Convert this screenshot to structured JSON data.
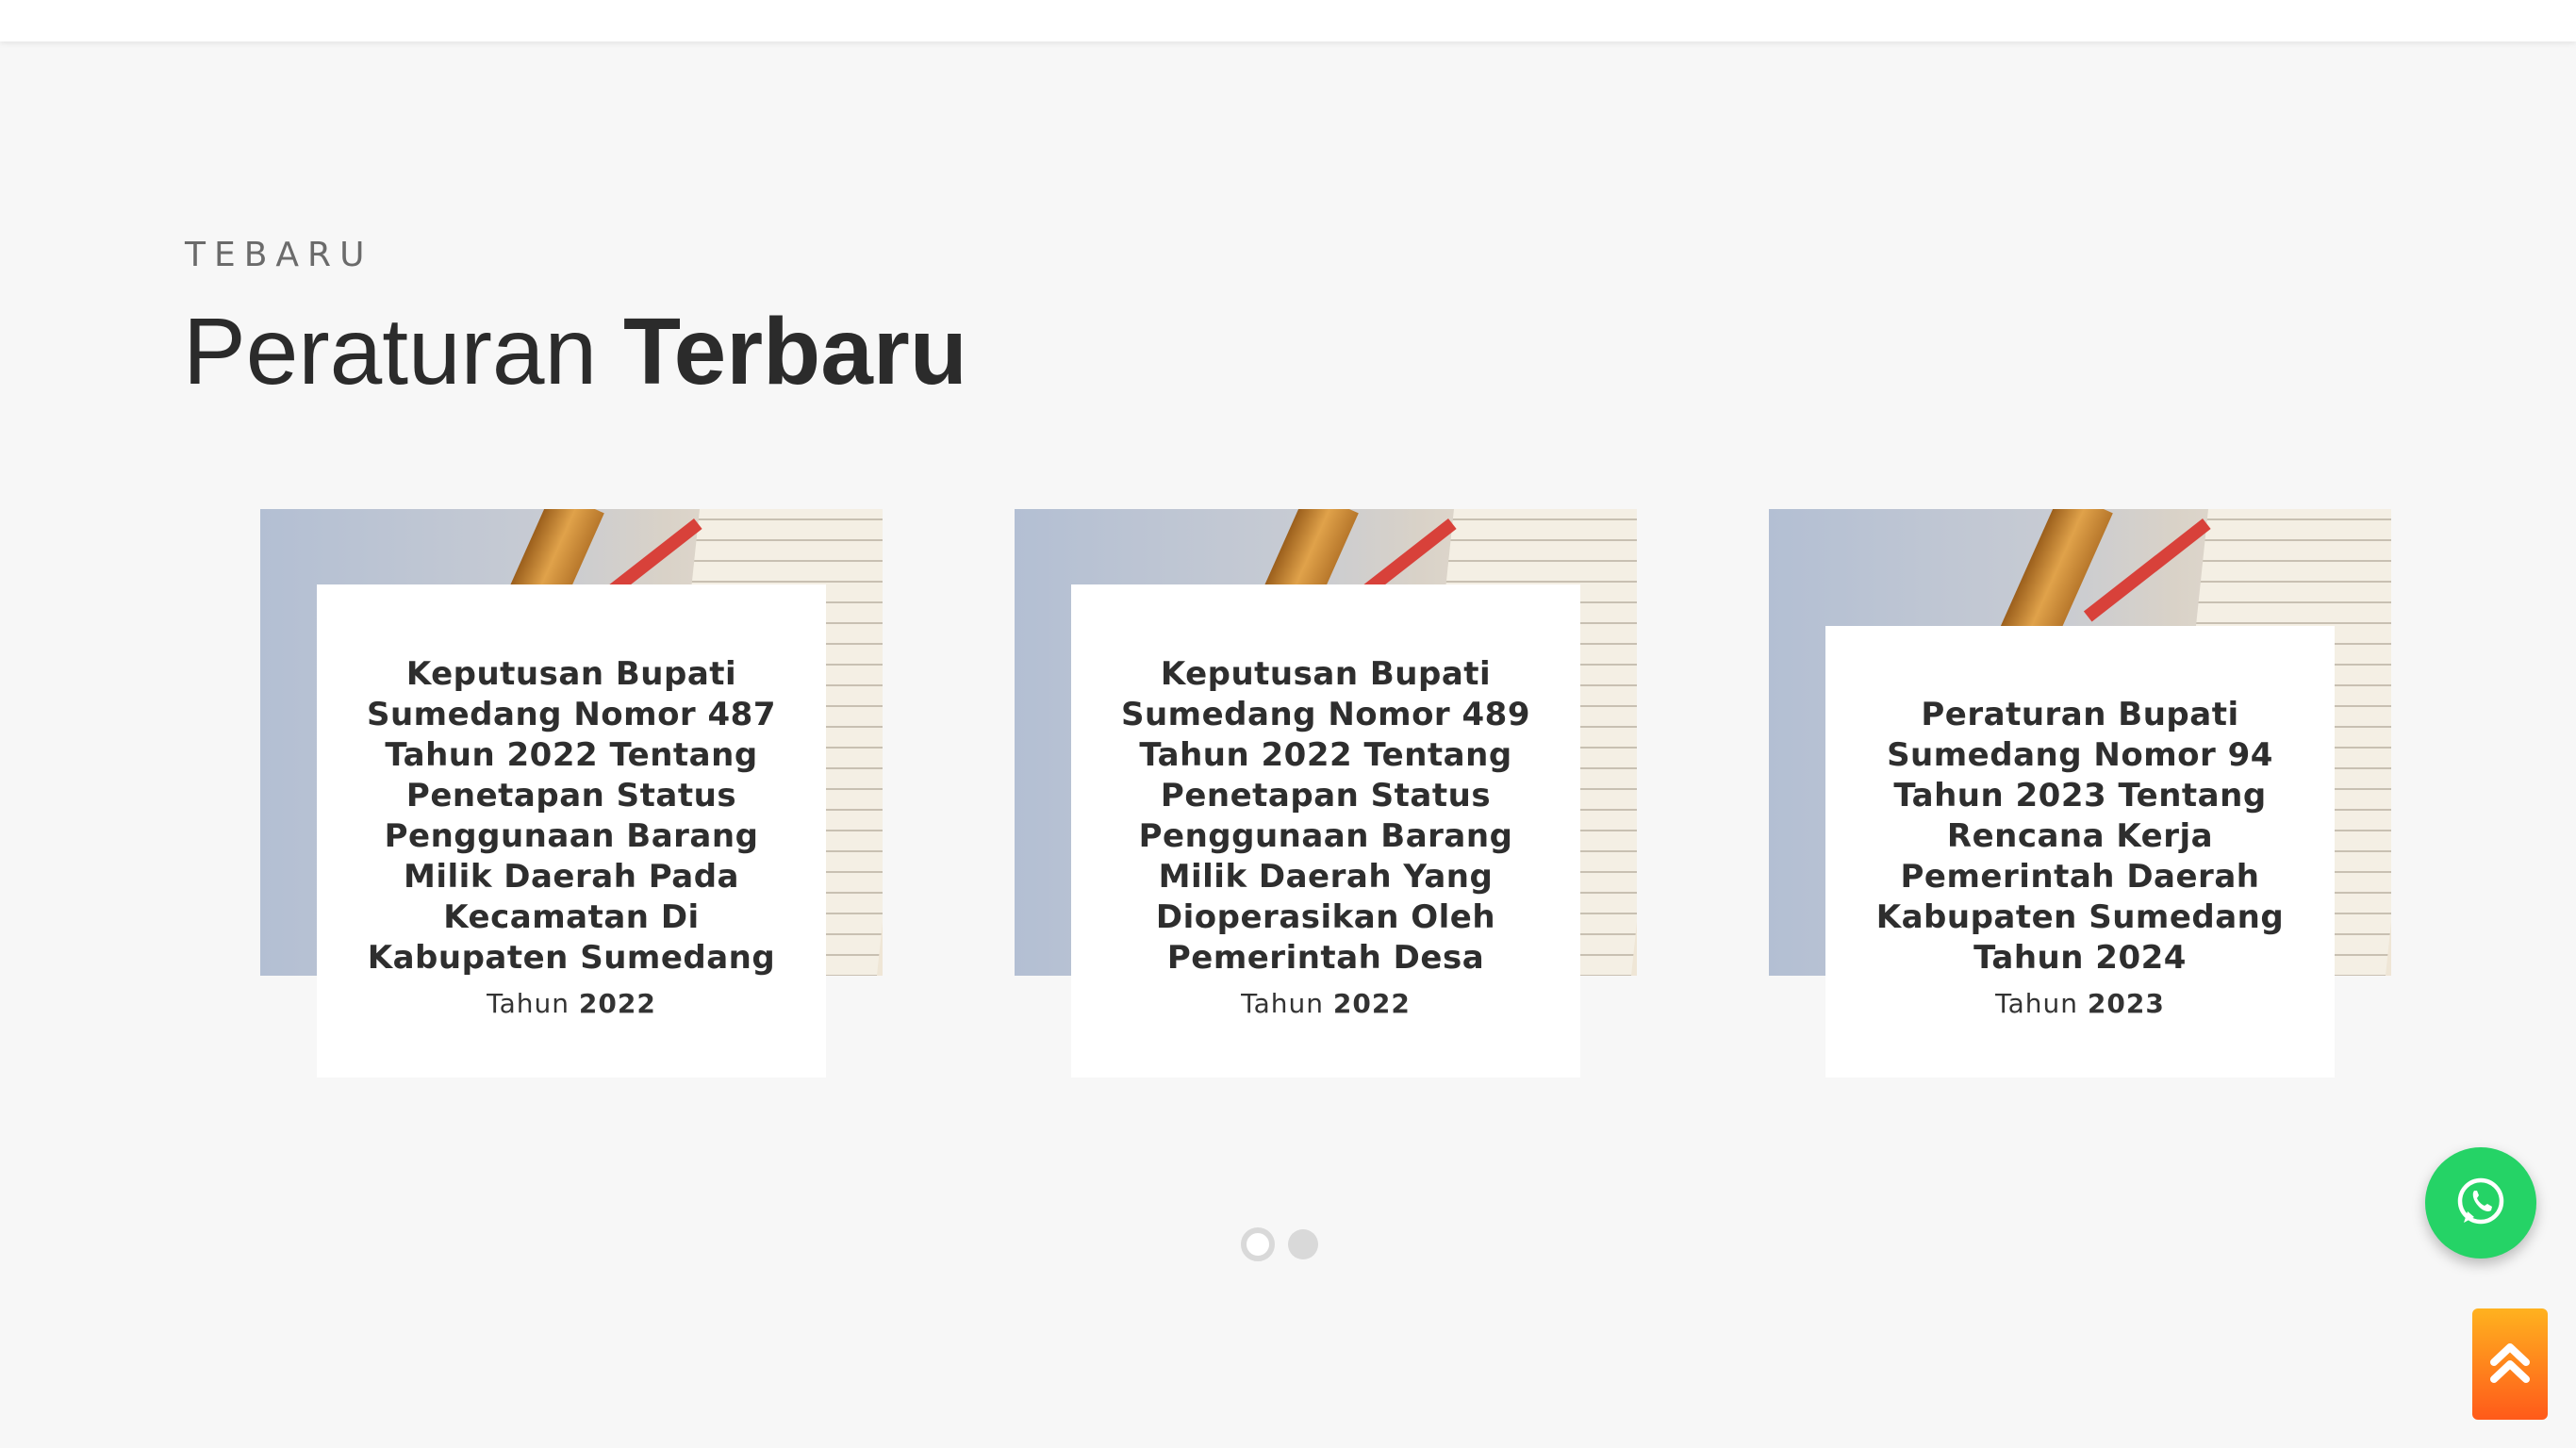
{
  "section": {
    "eyebrow": "TEBARU",
    "title_regular": "Peraturan",
    "title_bold": "Terbaru"
  },
  "cards": [
    {
      "title": "Keputusan Bupati Sumedang Nomor 487 Tahun 2022 Tentang Penetapan Status Penggunaan Barang Milik Daerah Pada Kecamatan Di Kabupaten Sumedang",
      "year_label": "Tahun",
      "year": "2022"
    },
    {
      "title": "Keputusan Bupati Sumedang Nomor 489 Tahun 2022 Tentang Penetapan Status Penggunaan Barang Milik Daerah Yang Dioperasikan Oleh Pemerintah Desa",
      "year_label": "Tahun",
      "year": "2022"
    },
    {
      "title": "Peraturan Bupati Sumedang Nomor 94 Tahun 2023 Tentang Rencana Kerja Pemerintah Daerah Kabupaten Sumedang Tahun 2024",
      "year_label": "Tahun",
      "year": "2023"
    }
  ],
  "carousel": {
    "pages": 2,
    "active_page": 1
  },
  "floating": {
    "whatsapp_icon": "whatsapp-icon",
    "scroll_top_icon": "double-chevron-up-icon"
  },
  "colors": {
    "background": "#f7f7f7",
    "whatsapp": "#25d366",
    "scroll_top_gradient_start": "#ffb21f",
    "scroll_top_gradient_end": "#ff5a1a",
    "title_text": "#2b2b2b"
  }
}
